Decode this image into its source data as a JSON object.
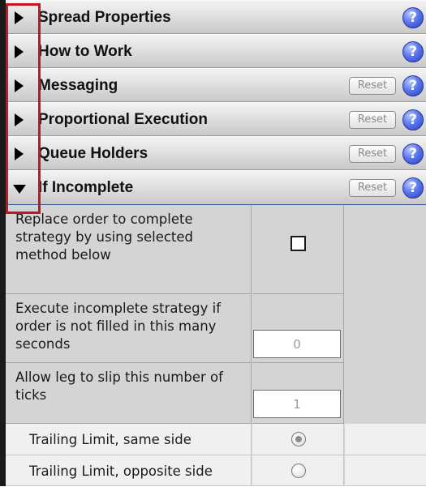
{
  "sections": [
    {
      "title": "Spread Properties",
      "expanded": false,
      "has_reset": false
    },
    {
      "title": "How to Work",
      "expanded": false,
      "has_reset": false
    },
    {
      "title": "Messaging",
      "expanded": false,
      "has_reset": true
    },
    {
      "title": "Proportional Execution",
      "expanded": false,
      "has_reset": true
    },
    {
      "title": "Queue Holders",
      "expanded": false,
      "has_reset": true
    },
    {
      "title": "If Incomplete",
      "expanded": true,
      "has_reset": true
    }
  ],
  "reset_label": "Reset",
  "help_glyph": "?",
  "if_incomplete": {
    "replace_order_label": "Replace order to complete strategy by using selected method below",
    "replace_order_checked": false,
    "execute_incomplete_label": "Execute incomplete strategy if order is not filled in this many seconds",
    "execute_incomplete_value": "0",
    "slip_ticks_label": "Allow leg to slip this number of ticks",
    "slip_ticks_value": "1",
    "options": [
      {
        "label": "Trailing Limit, same side",
        "selected": true
      },
      {
        "label": "Trailing Limit, opposite side",
        "selected": false
      }
    ]
  },
  "icons": {
    "expand": "triangle-right-icon",
    "collapse": "triangle-down-icon",
    "help": "question-mark-icon"
  },
  "colors": {
    "highlight": "#c8141e",
    "help_blue": "#3a55e0",
    "header_gray": "#dcdcdc",
    "body_gray": "#d4d4d4"
  }
}
